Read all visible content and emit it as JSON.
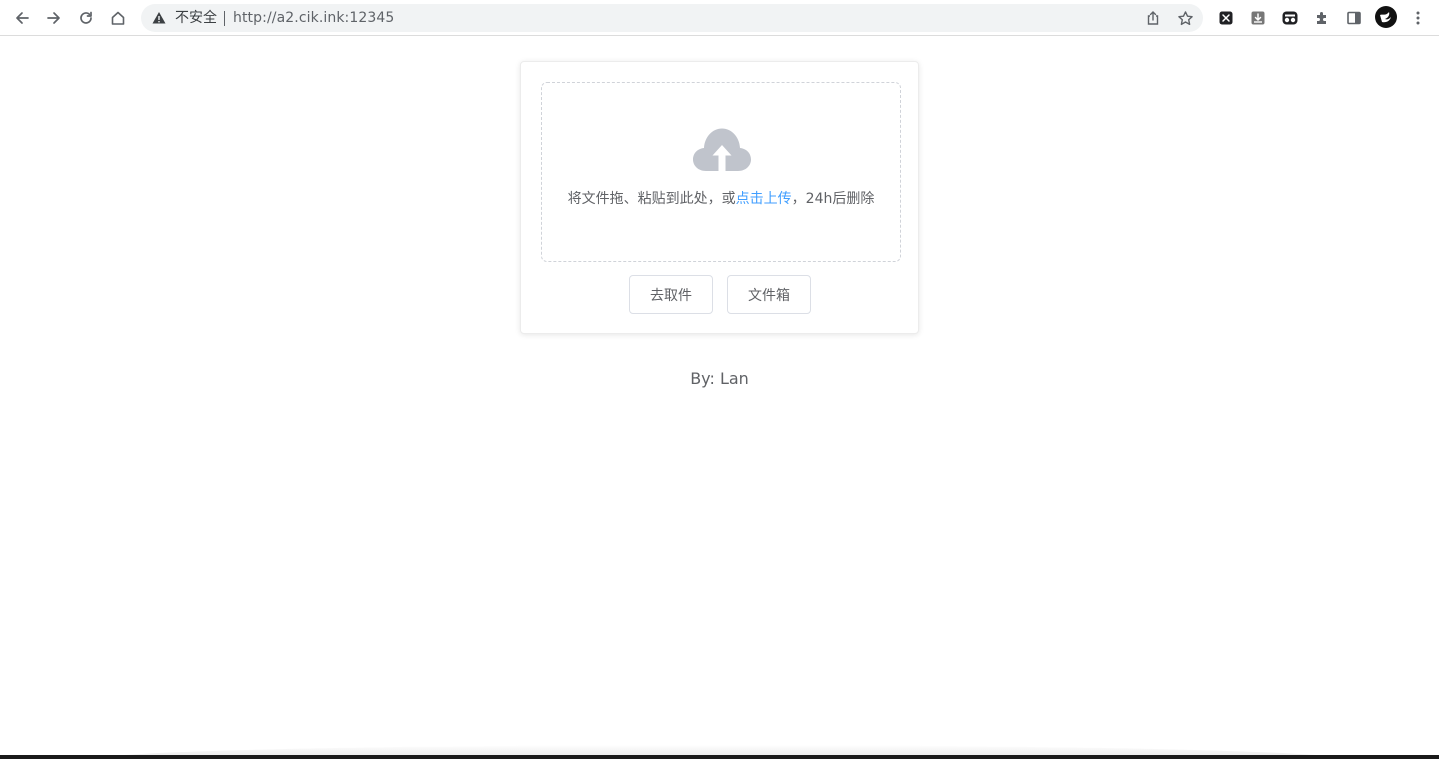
{
  "browser": {
    "security_label": "不安全",
    "url": "http://a2.cik.ink:12345"
  },
  "upload": {
    "text_before": "将文件拖、粘贴到此处，或",
    "link_text": "点击上传",
    "text_after": "，24h后删除"
  },
  "buttons": {
    "pickup_label": "去取件",
    "filebox_label": "文件箱"
  },
  "footer": {
    "credit": "By: Lan"
  },
  "colors": {
    "accent": "#409eff",
    "cloud_icon": "#c0c4cc"
  }
}
